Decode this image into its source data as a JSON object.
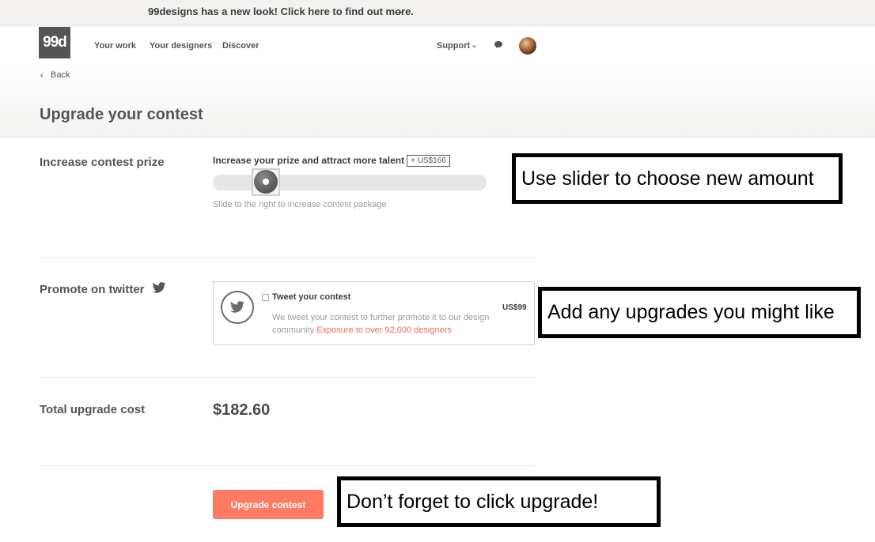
{
  "announcement": {
    "text": "99designs has a new look! Click here to find out more.",
    "arrow_icon": "arrow-right-icon"
  },
  "header": {
    "logo_text": "99d",
    "nav": [
      "Your work",
      "Your designers",
      "Discover"
    ],
    "support_label": "Support",
    "chat_icon": "chat-bubble-icon",
    "avatar": "user-avatar"
  },
  "back_label": "Back",
  "page_title": "Upgrade your contest",
  "prize_section": {
    "label": "Increase contest prize",
    "heading": "Increase your prize and attract more talent",
    "badge": "+ US$166",
    "slider_level": 0.15,
    "hint": "Slide to the right to increase contest package"
  },
  "twitter_section": {
    "label": "Promote on twitter",
    "card_title": "Tweet your contest",
    "price": "US$99",
    "description": "We tweet your contest to further promote it to our design community",
    "highlight": "Exposure to over 92,000 designers",
    "checked": false
  },
  "total_section": {
    "label": "Total upgrade cost",
    "amount": "$182.60"
  },
  "upgrade_button": "Upgrade contest",
  "callouts": {
    "slider": "Use slider to choose new amount",
    "upgrades": "Add any upgrades you might like",
    "click": "Don’t forget to click upgrade!"
  },
  "colors": {
    "accent": "#ff7a62",
    "link_highlight": "#f26b57",
    "logo_bg": "#555555",
    "banner_bg": "#f2f1ef"
  }
}
